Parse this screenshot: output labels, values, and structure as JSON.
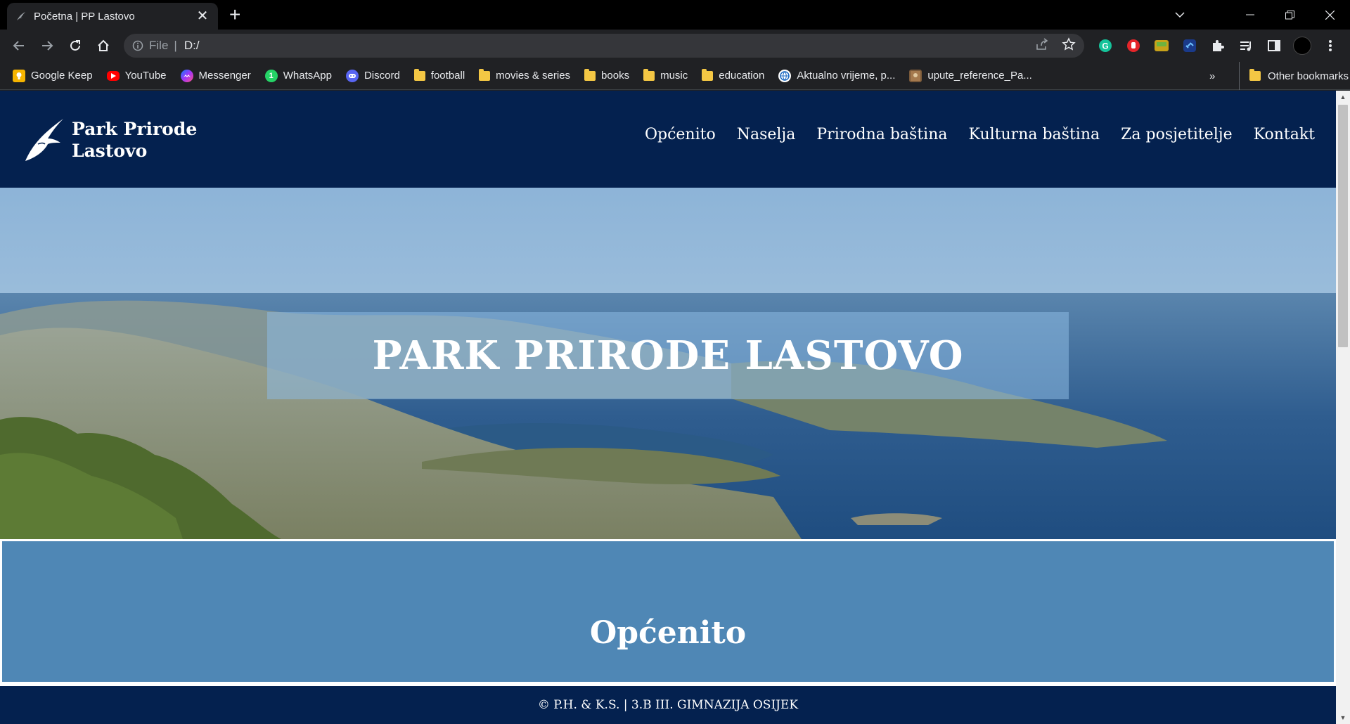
{
  "browser": {
    "tab": {
      "title": "Početna | PP Lastovo"
    },
    "address": {
      "scheme": "File",
      "url": "D:/"
    },
    "bookmarks": [
      {
        "label": "Google Keep",
        "icon": "keep-icon"
      },
      {
        "label": "YouTube",
        "icon": "youtube-icon"
      },
      {
        "label": "Messenger",
        "icon": "messenger-icon"
      },
      {
        "label": "WhatsApp",
        "icon": "whatsapp-icon"
      },
      {
        "label": "Discord",
        "icon": "discord-icon"
      },
      {
        "label": "football",
        "icon": "folder-icon"
      },
      {
        "label": "movies & series",
        "icon": "folder-icon"
      },
      {
        "label": "books",
        "icon": "folder-icon"
      },
      {
        "label": "music",
        "icon": "folder-icon"
      },
      {
        "label": "education",
        "icon": "folder-icon"
      },
      {
        "label": "Aktualno vrijeme, p...",
        "icon": "globe-icon"
      },
      {
        "label": "upute_reference_Pa...",
        "icon": "image-icon"
      }
    ],
    "bookmarks_more": "»",
    "other_bookmarks": "Other bookmarks"
  },
  "site": {
    "logo": {
      "line1": "Park Prirode",
      "line2": "Lastovo"
    },
    "nav": [
      "Općenito",
      "Naselja",
      "Prirodna baština",
      "Kulturna baština",
      "Za posjetitelje",
      "Kontakt"
    ],
    "hero_title": "PARK PRIRODE LASTOVO",
    "section_title": "Općenito",
    "footer": "© P.H. & K.S. | 3.B III. GIMNAZIJA OSIJEK"
  },
  "colors": {
    "header_bg": "#04214f",
    "section_bg": "#4f87b5",
    "hero_banner": "rgba(140,185,225,0.55)"
  }
}
